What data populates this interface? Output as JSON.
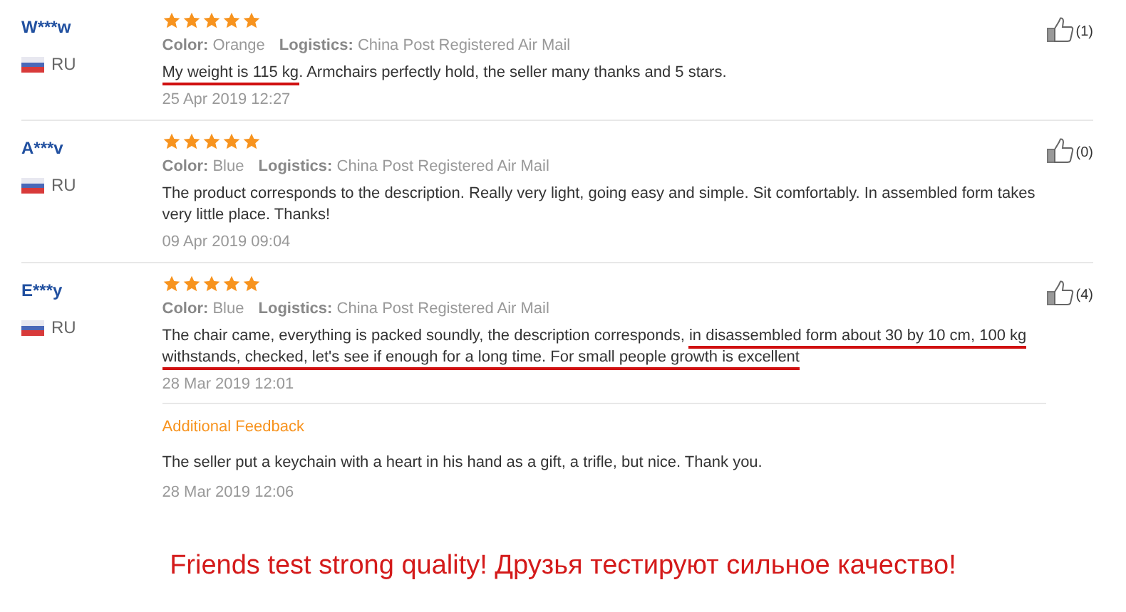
{
  "reviews": [
    {
      "user": "W***w",
      "country": "RU",
      "stars": 5,
      "color_label": "Color:",
      "color_value": "Orange",
      "logistics_label": "Logistics:",
      "logistics_value": "China Post Registered Air Mail",
      "likes": "(1)",
      "text": [
        {
          "text": "My weight is 115 kg",
          "underlined": true
        },
        {
          "text": ". Armchairs perfectly hold, the seller many thanks and 5 stars.",
          "underlined": false
        }
      ],
      "date": "25 Apr 2019 12:27"
    },
    {
      "user": "A***v",
      "country": "RU",
      "stars": 5,
      "color_label": "Color:",
      "color_value": "Blue",
      "logistics_label": "Logistics:",
      "logistics_value": "China Post Registered Air Mail",
      "likes": "(0)",
      "text": [
        {
          "text": "The product corresponds to the description. Really very light, going easy and simple. Sit comfortably. In assembled form takes very little place. Thanks!",
          "underlined": false
        }
      ],
      "date": "09 Apr 2019 09:04"
    },
    {
      "user": "E***y",
      "country": "RU",
      "stars": 5,
      "color_label": "Color:",
      "color_value": "Blue",
      "logistics_label": "Logistics:",
      "logistics_value": "China Post Registered Air Mail",
      "likes": "(4)",
      "text": [
        {
          "text": "The chair came, everything is packed soundly, the description corresponds, ",
          "underlined": false
        },
        {
          "text": "in disassembled form about 30 by 10 cm, 100 kg withstands, checked, let's see if enough for a long time. For small people growth is excellent",
          "underlined": true
        }
      ],
      "date": "28 Mar 2019 12:01",
      "additional": {
        "title": "Additional Feedback",
        "text": "The seller put a keychain with a heart in his hand as a gift, a trifle, but nice. Thank you.",
        "date": "28 Mar 2019 12:06"
      }
    }
  ],
  "caption": "Friends test strong quality! Друзья тестируют сильное качество!"
}
